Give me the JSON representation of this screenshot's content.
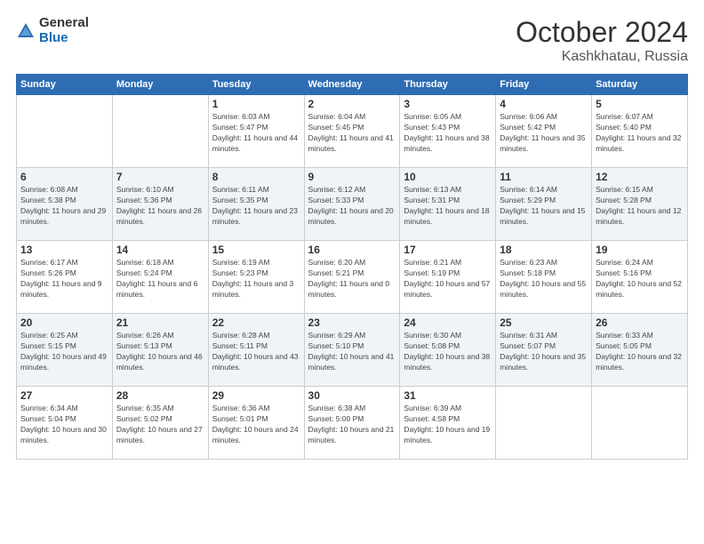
{
  "logo": {
    "general": "General",
    "blue": "Blue"
  },
  "header": {
    "month": "October 2024",
    "location": "Kashkhatau, Russia"
  },
  "weekdays": [
    "Sunday",
    "Monday",
    "Tuesday",
    "Wednesday",
    "Thursday",
    "Friday",
    "Saturday"
  ],
  "weeks": [
    [
      {
        "day": "",
        "info": ""
      },
      {
        "day": "",
        "info": ""
      },
      {
        "day": "1",
        "info": "Sunrise: 6:03 AM\nSunset: 5:47 PM\nDaylight: 11 hours and 44 minutes."
      },
      {
        "day": "2",
        "info": "Sunrise: 6:04 AM\nSunset: 5:45 PM\nDaylight: 11 hours and 41 minutes."
      },
      {
        "day": "3",
        "info": "Sunrise: 6:05 AM\nSunset: 5:43 PM\nDaylight: 11 hours and 38 minutes."
      },
      {
        "day": "4",
        "info": "Sunrise: 6:06 AM\nSunset: 5:42 PM\nDaylight: 11 hours and 35 minutes."
      },
      {
        "day": "5",
        "info": "Sunrise: 6:07 AM\nSunset: 5:40 PM\nDaylight: 11 hours and 32 minutes."
      }
    ],
    [
      {
        "day": "6",
        "info": "Sunrise: 6:08 AM\nSunset: 5:38 PM\nDaylight: 11 hours and 29 minutes."
      },
      {
        "day": "7",
        "info": "Sunrise: 6:10 AM\nSunset: 5:36 PM\nDaylight: 11 hours and 26 minutes."
      },
      {
        "day": "8",
        "info": "Sunrise: 6:11 AM\nSunset: 5:35 PM\nDaylight: 11 hours and 23 minutes."
      },
      {
        "day": "9",
        "info": "Sunrise: 6:12 AM\nSunset: 5:33 PM\nDaylight: 11 hours and 20 minutes."
      },
      {
        "day": "10",
        "info": "Sunrise: 6:13 AM\nSunset: 5:31 PM\nDaylight: 11 hours and 18 minutes."
      },
      {
        "day": "11",
        "info": "Sunrise: 6:14 AM\nSunset: 5:29 PM\nDaylight: 11 hours and 15 minutes."
      },
      {
        "day": "12",
        "info": "Sunrise: 6:15 AM\nSunset: 5:28 PM\nDaylight: 11 hours and 12 minutes."
      }
    ],
    [
      {
        "day": "13",
        "info": "Sunrise: 6:17 AM\nSunset: 5:26 PM\nDaylight: 11 hours and 9 minutes."
      },
      {
        "day": "14",
        "info": "Sunrise: 6:18 AM\nSunset: 5:24 PM\nDaylight: 11 hours and 6 minutes."
      },
      {
        "day": "15",
        "info": "Sunrise: 6:19 AM\nSunset: 5:23 PM\nDaylight: 11 hours and 3 minutes."
      },
      {
        "day": "16",
        "info": "Sunrise: 6:20 AM\nSunset: 5:21 PM\nDaylight: 11 hours and 0 minutes."
      },
      {
        "day": "17",
        "info": "Sunrise: 6:21 AM\nSunset: 5:19 PM\nDaylight: 10 hours and 57 minutes."
      },
      {
        "day": "18",
        "info": "Sunrise: 6:23 AM\nSunset: 5:18 PM\nDaylight: 10 hours and 55 minutes."
      },
      {
        "day": "19",
        "info": "Sunrise: 6:24 AM\nSunset: 5:16 PM\nDaylight: 10 hours and 52 minutes."
      }
    ],
    [
      {
        "day": "20",
        "info": "Sunrise: 6:25 AM\nSunset: 5:15 PM\nDaylight: 10 hours and 49 minutes."
      },
      {
        "day": "21",
        "info": "Sunrise: 6:26 AM\nSunset: 5:13 PM\nDaylight: 10 hours and 46 minutes."
      },
      {
        "day": "22",
        "info": "Sunrise: 6:28 AM\nSunset: 5:11 PM\nDaylight: 10 hours and 43 minutes."
      },
      {
        "day": "23",
        "info": "Sunrise: 6:29 AM\nSunset: 5:10 PM\nDaylight: 10 hours and 41 minutes."
      },
      {
        "day": "24",
        "info": "Sunrise: 6:30 AM\nSunset: 5:08 PM\nDaylight: 10 hours and 38 minutes."
      },
      {
        "day": "25",
        "info": "Sunrise: 6:31 AM\nSunset: 5:07 PM\nDaylight: 10 hours and 35 minutes."
      },
      {
        "day": "26",
        "info": "Sunrise: 6:33 AM\nSunset: 5:05 PM\nDaylight: 10 hours and 32 minutes."
      }
    ],
    [
      {
        "day": "27",
        "info": "Sunrise: 6:34 AM\nSunset: 5:04 PM\nDaylight: 10 hours and 30 minutes."
      },
      {
        "day": "28",
        "info": "Sunrise: 6:35 AM\nSunset: 5:02 PM\nDaylight: 10 hours and 27 minutes."
      },
      {
        "day": "29",
        "info": "Sunrise: 6:36 AM\nSunset: 5:01 PM\nDaylight: 10 hours and 24 minutes."
      },
      {
        "day": "30",
        "info": "Sunrise: 6:38 AM\nSunset: 5:00 PM\nDaylight: 10 hours and 21 minutes."
      },
      {
        "day": "31",
        "info": "Sunrise: 6:39 AM\nSunset: 4:58 PM\nDaylight: 10 hours and 19 minutes."
      },
      {
        "day": "",
        "info": ""
      },
      {
        "day": "",
        "info": ""
      }
    ]
  ]
}
